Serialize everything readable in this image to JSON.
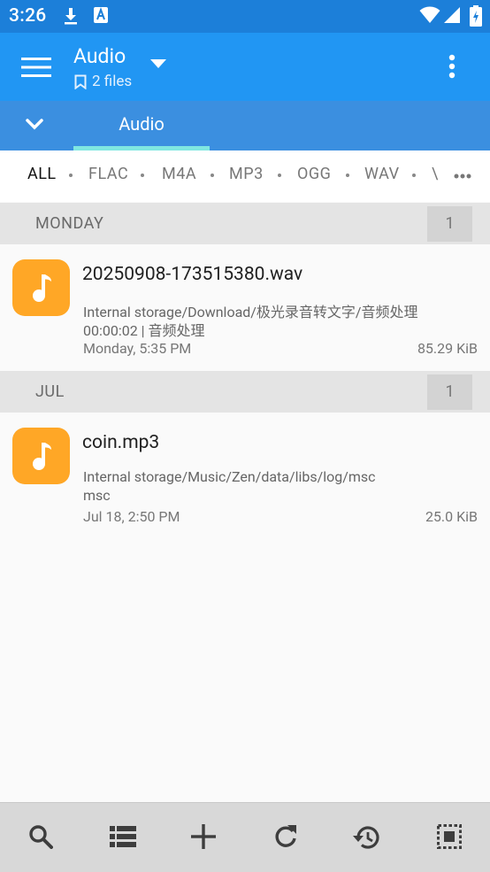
{
  "status_bar": {
    "time": "3:26"
  },
  "app_bar": {
    "title": "Audio",
    "subtitle": "2 files"
  },
  "tabs": [
    {
      "label": "Audio"
    }
  ],
  "filters": [
    "ALL",
    "FLAC",
    "M4A",
    "MP3",
    "OGG",
    "WAV",
    "\\"
  ],
  "sections": [
    {
      "label": "MONDAY",
      "count": "1",
      "item": {
        "name": "20250908-173515380.wav",
        "path": "Internal storage/Download/极光录音转文字/音频处理",
        "meta": "00:00:02  |  音频处理",
        "date": "Monday, 5:35 PM",
        "size": "85.29 KiB"
      }
    },
    {
      "label": "JUL",
      "count": "1",
      "item": {
        "name": "coin.mp3",
        "path": "Internal storage/Music/Zen/data/libs/log/msc",
        "meta": "msc",
        "date": "Jul 18, 2:50 PM",
        "size": "25.0 KiB"
      }
    }
  ],
  "colors": {
    "status_bar": "#1c7fd9",
    "app_bar": "#2196f3",
    "tab_bar": "#3b8fe0",
    "tab_indicator": "#7fe7e1",
    "file_icon": "#ffa726"
  }
}
